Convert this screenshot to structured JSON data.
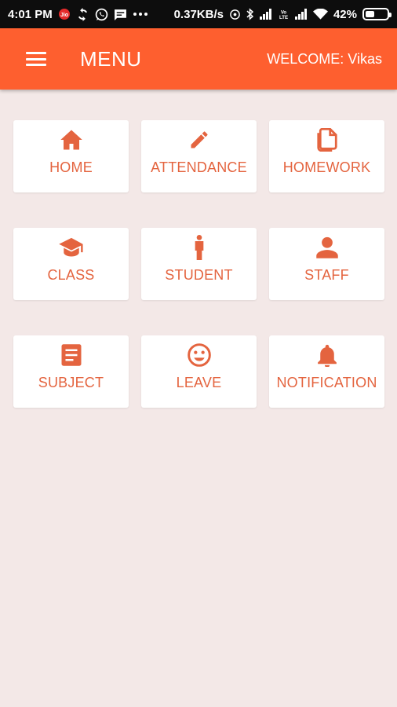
{
  "status_bar": {
    "time": "4:01 PM",
    "network_speed": "0.37KB/s",
    "battery": "42%",
    "battery_level": 0.42
  },
  "app_bar": {
    "title": "MENU",
    "welcome": "WELCOME: Vikas",
    "color": "#fe5f2f"
  },
  "menu": {
    "accent_color": "#e4643f",
    "items": [
      {
        "label": "HOME",
        "icon": "home-icon"
      },
      {
        "label": "ATTENDANCE",
        "icon": "pencil-icon"
      },
      {
        "label": "HOMEWORK",
        "icon": "document-icon"
      },
      {
        "label": "CLASS",
        "icon": "graduation-cap-icon"
      },
      {
        "label": "STUDENT",
        "icon": "person-standing-icon"
      },
      {
        "label": "STAFF",
        "icon": "person-icon"
      },
      {
        "label": "SUBJECT",
        "icon": "notes-icon"
      },
      {
        "label": "LEAVE",
        "icon": "smiley-icon"
      },
      {
        "label": "NOTIFICATION",
        "icon": "bell-icon"
      }
    ]
  }
}
